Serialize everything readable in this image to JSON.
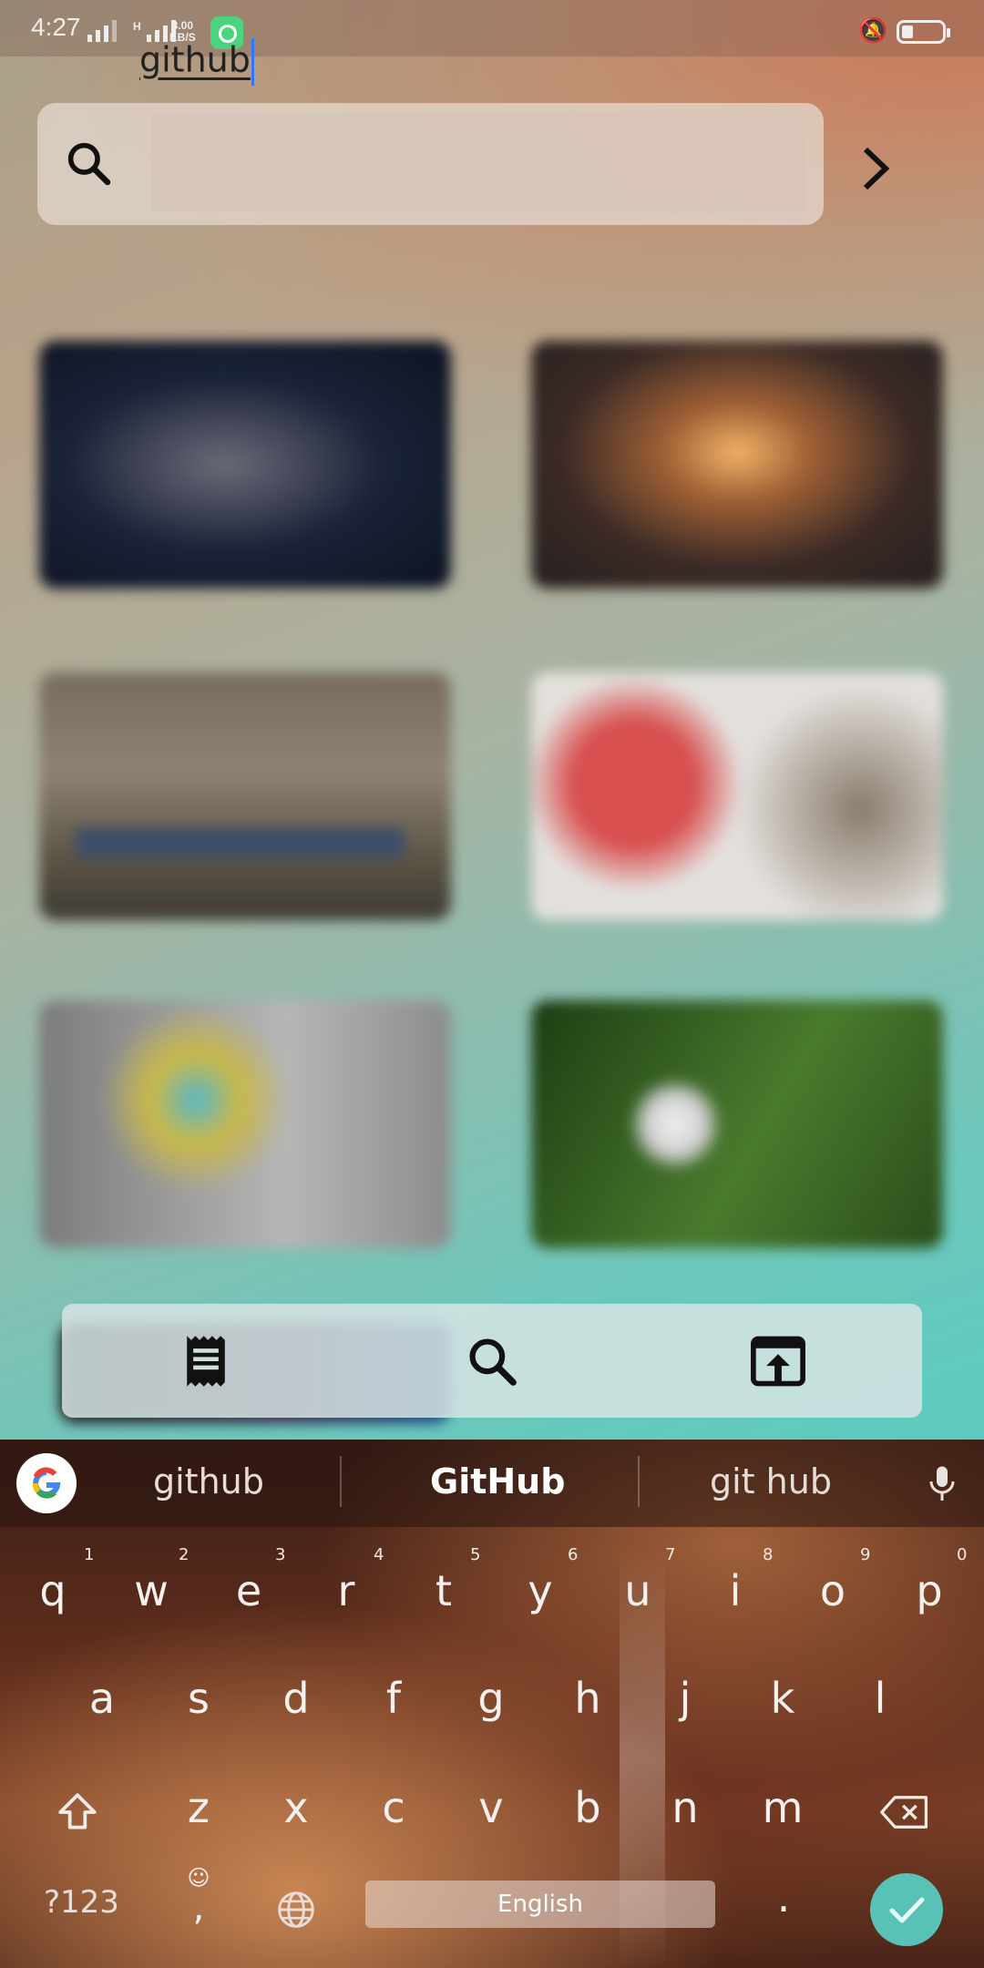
{
  "status_bar": {
    "time": "4:27",
    "network_speed_value": "3.00",
    "network_speed_unit": "KB/S",
    "network_type": "H"
  },
  "search": {
    "value": "github",
    "placeholder": ""
  },
  "bottom_nav": {
    "icons": [
      "receipt-icon",
      "search-icon",
      "open-in-browser-icon"
    ]
  },
  "keyboard": {
    "suggestions": [
      "github",
      "GitHub",
      "git hub"
    ],
    "row1": [
      "q",
      "w",
      "e",
      "r",
      "t",
      "y",
      "u",
      "i",
      "o",
      "p"
    ],
    "row1_hints": [
      "1",
      "2",
      "3",
      "4",
      "5",
      "6",
      "7",
      "8",
      "9",
      "0"
    ],
    "row2": [
      "a",
      "s",
      "d",
      "f",
      "g",
      "h",
      "j",
      "k",
      "l"
    ],
    "row3": [
      "z",
      "x",
      "c",
      "v",
      "b",
      "n",
      "m"
    ],
    "symbols_label": "?123",
    "comma_label": ",",
    "language_label": "English",
    "period_label": ".",
    "accent_color": "#59c2b6"
  }
}
